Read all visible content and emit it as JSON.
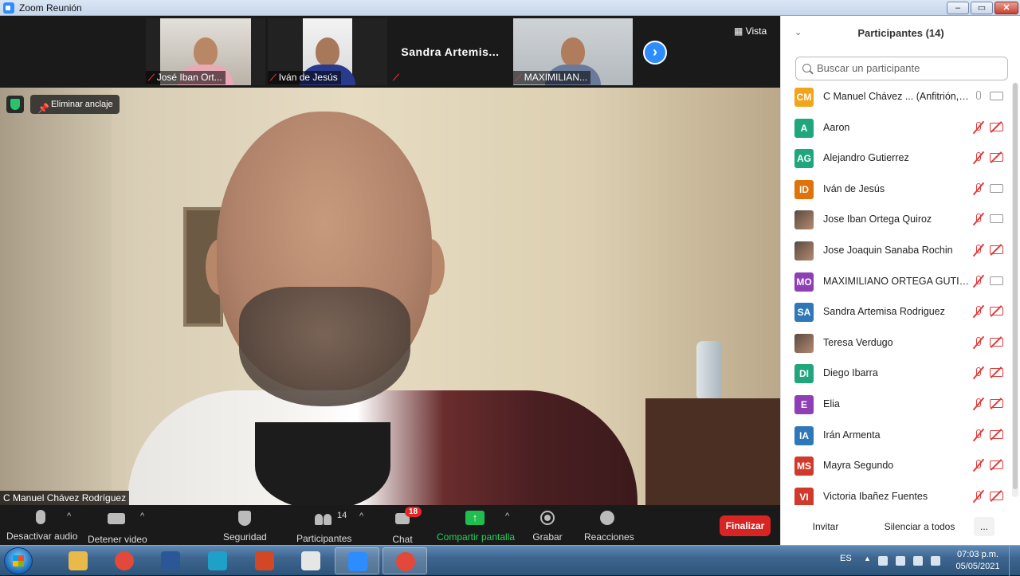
{
  "window": {
    "title": "Zoom Reunión",
    "controls": {
      "minimize": "–",
      "maximize": "▭",
      "close": "✕"
    }
  },
  "thumbnails": [
    {
      "name": "José Iban Ort...",
      "muted": true
    },
    {
      "name": "Iván de Jesús",
      "muted": true
    },
    {
      "name": "Sandra Artemis...",
      "big_label": "Sandra  Artemis...",
      "muted": true,
      "video": false
    },
    {
      "name": "MAXIMILIAN...",
      "muted": true
    }
  ],
  "view_button": "Vista",
  "pin_button": "Eliminar anclaje",
  "active_speaker": "C Manuel Chávez Rodríguez",
  "toolbar": {
    "mute_label": "Desactivar audio",
    "video_label": "Detener video",
    "security_label": "Seguridad",
    "participants_label": "Participantes",
    "participants_count": "14",
    "chat_label": "Chat",
    "chat_badge": "18",
    "share_label": "Compartir pantalla",
    "record_label": "Grabar",
    "reactions_label": "Reacciones",
    "end_label": "Finalizar"
  },
  "panel": {
    "title": "Participantes (14)",
    "search_placeholder": "Buscar un participante",
    "participants": [
      {
        "initials": "CM",
        "name": "C Manuel Chávez ... (Anfitrión, yo)",
        "color": "#f2a51a",
        "mic": "on",
        "cam": "on"
      },
      {
        "initials": "A",
        "name": "Aaron",
        "color": "#1fa77b",
        "mic": "off",
        "cam": "off"
      },
      {
        "initials": "AG",
        "name": "Alejandro Gutierrez",
        "color": "#1fa77b",
        "mic": "off",
        "cam": "off"
      },
      {
        "initials": "ID",
        "name": "Iván de Jesús",
        "color": "#e0720c",
        "mic": "off",
        "cam": "on"
      },
      {
        "initials": "",
        "name": "Jose Iban Ortega Quiroz",
        "color": "photo",
        "mic": "off",
        "cam": "on"
      },
      {
        "initials": "",
        "name": "Jose Joaquin Sanaba Rochin",
        "color": "photo",
        "mic": "off",
        "cam": "off"
      },
      {
        "initials": "MO",
        "name": "MAXIMILIANO ORTEGA GUTIÉRREZ",
        "color": "#8e3fb5",
        "mic": "off",
        "cam": "on"
      },
      {
        "initials": "SA",
        "name": "Sandra Artemisa Rodriguez",
        "color": "#2e78b8",
        "mic": "off",
        "cam": "off"
      },
      {
        "initials": "",
        "name": "Teresa Verdugo",
        "color": "photo",
        "mic": "off",
        "cam": "off"
      },
      {
        "initials": "DI",
        "name": "Diego Ibarra",
        "color": "#1fa77b",
        "mic": "off",
        "cam": "off"
      },
      {
        "initials": "E",
        "name": "Elia",
        "color": "#8e3fb5",
        "mic": "off",
        "cam": "off"
      },
      {
        "initials": "IA",
        "name": "Irán Armenta",
        "color": "#2e78b8",
        "mic": "off",
        "cam": "off"
      },
      {
        "initials": "MS",
        "name": "Mayra Segundo",
        "color": "#d0392b",
        "mic": "off",
        "cam": "off"
      },
      {
        "initials": "VI",
        "name": "Victoria Ibañez Fuentes",
        "color": "#d0392b",
        "mic": "off",
        "cam": "off"
      }
    ],
    "invite_label": "Invitar",
    "mute_all_label": "Silenciar a todos",
    "more_label": "..."
  },
  "taskbar": {
    "apps": [
      {
        "name": "file-explorer",
        "color": "#e9b949"
      },
      {
        "name": "chrome",
        "color": "#e2493b"
      },
      {
        "name": "word",
        "color": "#2b5797"
      },
      {
        "name": "edge",
        "color": "#1fa0c9"
      },
      {
        "name": "powerpoint",
        "color": "#d24726"
      },
      {
        "name": "snipping-tool",
        "color": "#e6e6e6"
      },
      {
        "name": "zoom",
        "color": "#2d8cff"
      },
      {
        "name": "chrome-active",
        "color": "#e2493b"
      }
    ],
    "language": "ES",
    "time": "07:03 p.m.",
    "date": "05/05/2021"
  }
}
